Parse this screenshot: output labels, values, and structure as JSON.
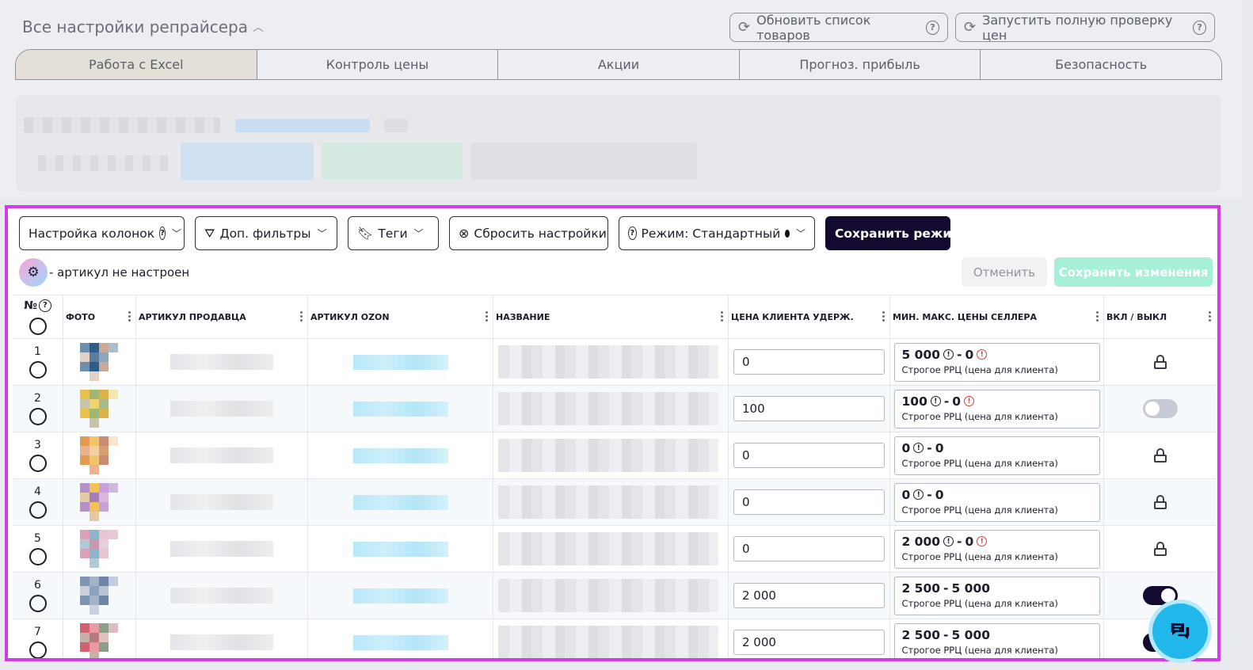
{
  "header": {
    "title": "Все настройки репрайсера",
    "update_btn": "Обновить список товаров",
    "check_btn": "Запустить полную проверку цен"
  },
  "tabs": [
    "Работа с Excel",
    "Контроль цены",
    "Акции",
    "Прогноз. прибыль",
    "Безопасность"
  ],
  "toolbar": {
    "columns": "Настройка колонок",
    "filters": "Доп. фильтры",
    "tags": "Теги",
    "reset": "Сбросить настройки",
    "mode": "Режим: Стандартный",
    "save_mode": "Сохранить режим"
  },
  "status": {
    "text": "- артикул не настроен"
  },
  "actions": {
    "cancel": "Отменить",
    "save": "Сохранить изменения"
  },
  "table": {
    "headers": {
      "num": "№",
      "photo": "ФОТО",
      "seller": "АРТИКУЛ ПРОДАВЦА",
      "ozon": "АРТИКУЛ OZON",
      "name": "НАЗВАНИЕ",
      "price": "ЦЕНА КЛИЕНТА УДЕРЖ.",
      "minmax": "МИН. МАКС. ЦЕНЫ СЕЛЛЕРА",
      "toggle": "ВКЛ / ВЫКЛ"
    },
    "rows": [
      {
        "num": "1",
        "price": "0",
        "min": "5 000",
        "max": "0",
        "sub": "Строгое РРЦ (цена для клиента)",
        "state": "locked"
      },
      {
        "num": "2",
        "price": "100",
        "min": "100",
        "max": "0",
        "sub": "Строгое РРЦ (цена для клиента)",
        "state": "off"
      },
      {
        "num": "3",
        "price": "0",
        "min": "0",
        "max": "0",
        "sub": "Строгое РРЦ (цена для клиента)",
        "state": "locked"
      },
      {
        "num": "4",
        "price": "0",
        "min": "0",
        "max": "0",
        "sub": "Строгое РРЦ (цена для клиента)",
        "state": "locked"
      },
      {
        "num": "5",
        "price": "0",
        "min": "2 000",
        "max": "0",
        "sub": "Строгое РРЦ (цена для клиента)",
        "state": "locked"
      },
      {
        "num": "6",
        "price": "2 000",
        "min": "2 500",
        "max": "5 000",
        "sub": "Строгое РРЦ (цена для клиента)",
        "state": "on"
      },
      {
        "num": "7",
        "price": "2 000",
        "min": "2 500",
        "max": "5 000",
        "sub": "Строгое РРЦ (цена для клиента)",
        "state": "on"
      }
    ]
  }
}
